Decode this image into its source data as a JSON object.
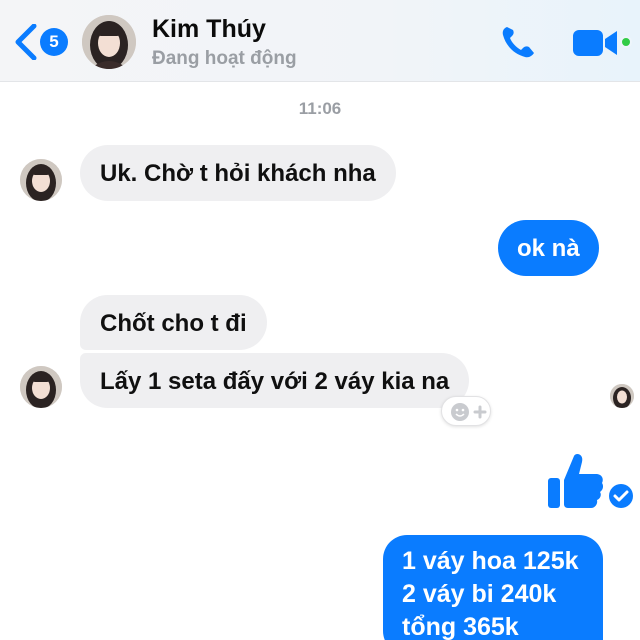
{
  "header": {
    "back_badge": "5",
    "contact_name": "Kim Thúy",
    "contact_status": "Đang hoạt động"
  },
  "conversation": {
    "timestamp": "11:06",
    "messages": [
      {
        "from": "contact",
        "text": "Uk. Chờ t hỏi khách nha"
      },
      {
        "from": "me",
        "text": "ok nà"
      },
      {
        "from": "contact",
        "text": "Chốt cho t đi"
      },
      {
        "from": "contact",
        "text": "Lấy 1 seta đấy với 2 váy kia na"
      },
      {
        "from": "me",
        "type": "like-sticker"
      },
      {
        "from": "me",
        "lines": [
          "1 váy hoa 125k",
          "2 váy bi 240k",
          "tổng 365k"
        ]
      }
    ]
  },
  "colors": {
    "accent": "#0a7cff",
    "incoming_bubble": "#efeff1",
    "online": "#31cc46",
    "muted_text": "#9a9ea4"
  },
  "icons": [
    "back-chevron-icon",
    "phone-icon",
    "video-camera-icon",
    "add-reaction-icon",
    "thumbs-up-icon",
    "seen-check-icon"
  ]
}
